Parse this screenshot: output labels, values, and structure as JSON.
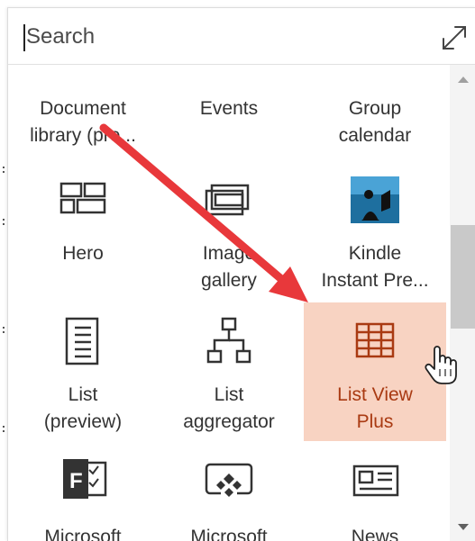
{
  "search": {
    "placeholder": "Search",
    "value": ""
  },
  "tiles": [
    {
      "label_line1": "Document",
      "label_line2": "library (pre...",
      "icon": "document-library-icon"
    },
    {
      "label_line1": "Events",
      "label_line2": "",
      "icon": "events-icon"
    },
    {
      "label_line1": "Group",
      "label_line2": "calendar",
      "icon": "group-calendar-icon"
    },
    {
      "label_line1": "Hero",
      "label_line2": "",
      "icon": "hero-icon"
    },
    {
      "label_line1": "Image",
      "label_line2": "gallery",
      "icon": "image-gallery-icon"
    },
    {
      "label_line1": "Kindle",
      "label_line2": "Instant Pre...",
      "icon": "kindle-icon"
    },
    {
      "label_line1": "List",
      "label_line2": "(preview)",
      "icon": "list-icon"
    },
    {
      "label_line1": "List",
      "label_line2": "aggregator",
      "icon": "list-aggregator-icon"
    },
    {
      "label_line1": "List View",
      "label_line2": "Plus",
      "icon": "list-view-plus-icon",
      "highlighted": true
    },
    {
      "label_line1": "Microsoft",
      "label_line2": "",
      "icon": "microsoft-forms-icon"
    },
    {
      "label_line1": "Microsoft",
      "label_line2": "",
      "icon": "microsoft-powerapps-icon"
    },
    {
      "label_line1": "News",
      "label_line2": "",
      "icon": "news-icon"
    }
  ],
  "colors": {
    "highlight_bg": "#f8d3c2",
    "highlight_text": "#a93a12",
    "arrow": "#e8383b",
    "icon": "#333333"
  }
}
